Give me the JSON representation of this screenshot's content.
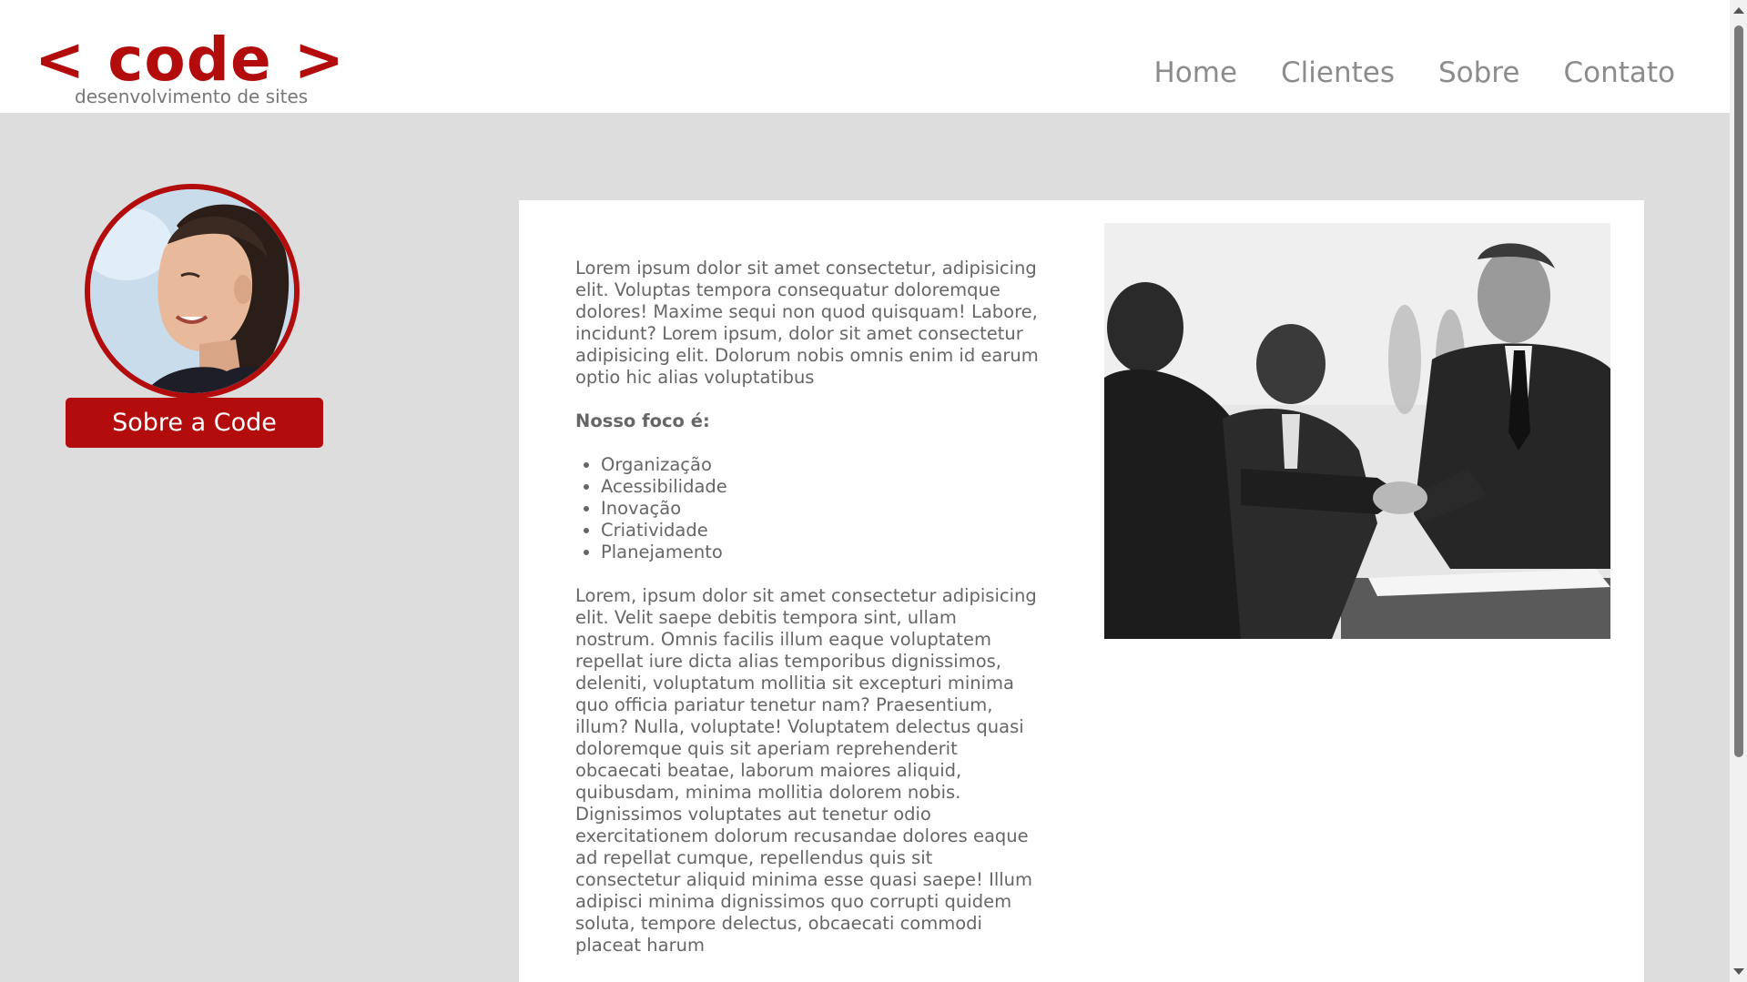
{
  "header": {
    "logo_main": "< code >",
    "logo_sub": "desenvolvimento de sites",
    "nav": [
      "Home",
      "Clientes",
      "Sobre",
      "Contato"
    ]
  },
  "sidebar": {
    "avatar_icon": "woman-portrait-photo",
    "button_label": "Sobre a Code"
  },
  "main": {
    "intro": "Lorem ipsum dolor sit amet consectetur, adipisicing elit. Voluptas tempora consequatur doloremque dolores! Maxime sequi non quod quisquam! Labore, incidunt? Lorem ipsum, dolor sit amet consectetur adipisicing elit. Dolorum nobis omnis enim id earum optio hic alias voluptatibus",
    "focus_title": "Nosso foco é:",
    "focus_items": [
      "Organização",
      "Acessibilidade",
      "Inovação",
      "Criatividade",
      "Planejamento"
    ],
    "body": "Lorem, ipsum dolor sit amet consectetur adipisicing elit. Velit saepe debitis tempora sint, ullam nostrum. Omnis facilis illum eaque voluptatem repellat iure dicta alias temporibus dignissimos, deleniti, voluptatum mollitia sit excepturi minima quo officia pariatur tenetur nam? Praesentium, illum? Nulla, voluptate! Voluptatem delectus quasi doloremque quis sit aperiam reprehenderit obcaecati beatae, laborum maiores aliquid, quibusdam, minima mollitia dolorem nobis. Dignissimos voluptates aut tenetur odio exercitationem dolorum recusandae dolores eaque ad repellat cumque, repellendus quis sit consectetur aliquid minima esse quasi saepe! Illum adipisci minima dignissimos quo corrupti quidem soluta, tempore delectus, obcaecati commodi placeat harum",
    "photo_icon": "business-handshake-photo"
  },
  "colors": {
    "brand_red": "#b30c0c",
    "background": "#dddddd",
    "text_gray": "#666666",
    "nav_gray": "#8c8c8c"
  }
}
